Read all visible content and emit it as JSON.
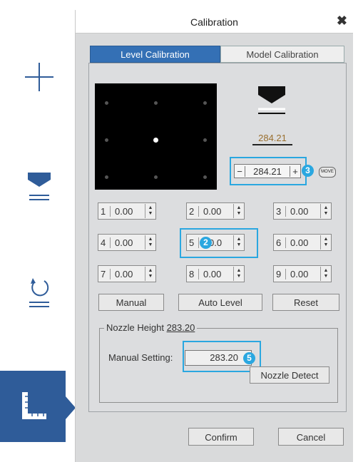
{
  "sidebar": {
    "tools": [
      "add-tool",
      "nozzle-tool",
      "reset-tool",
      "calibration-tool"
    ]
  },
  "dialog": {
    "title": "Calibration",
    "close_label": "✖",
    "tabs": [
      "Level Calibration",
      "Model Calibration"
    ],
    "active_tab": "Level Calibration"
  },
  "level": {
    "height_display": "284.21",
    "stepper": {
      "minus": "−",
      "value": "284.21",
      "plus": "+"
    },
    "move_label": "MOVE",
    "badges": {
      "stepper": "3",
      "point5": "2",
      "manual": "5"
    },
    "points": [
      {
        "num": "1",
        "value": "0.00"
      },
      {
        "num": "2",
        "value": "0.00"
      },
      {
        "num": "3",
        "value": "0.00"
      },
      {
        "num": "4",
        "value": "0.00"
      },
      {
        "num": "5",
        "value": "0.0"
      },
      {
        "num": "6",
        "value": "0.00"
      },
      {
        "num": "7",
        "value": "0.00"
      },
      {
        "num": "8",
        "value": "0.00"
      },
      {
        "num": "9",
        "value": "0.00"
      }
    ],
    "buttons": {
      "manual": "Manual",
      "auto_level": "Auto Level",
      "reset": "Reset"
    }
  },
  "nozzle": {
    "legend_label": "Nozzle Height",
    "legend_value": "283.20",
    "manual_label": "Manual Setting:",
    "manual_value": "283.20",
    "detect_label": "Nozzle Detect"
  },
  "footer": {
    "confirm": "Confirm",
    "cancel": "Cancel"
  },
  "colors": {
    "accent": "#3470b5",
    "highlight": "#2aa7e0",
    "sidebar_active": "#2f5c99",
    "height_text": "#9a6f2f"
  }
}
